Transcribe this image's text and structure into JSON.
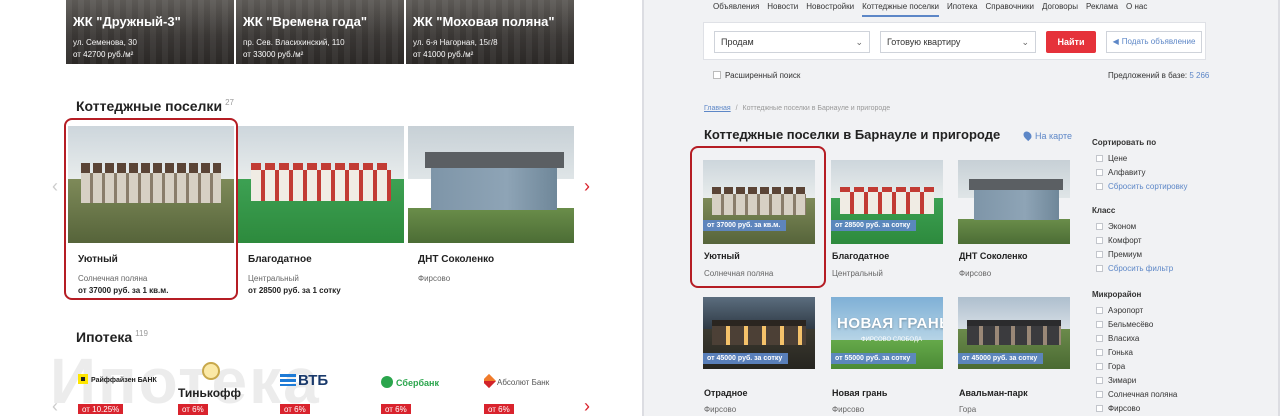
{
  "left": {
    "jk_cards": [
      {
        "name": "ЖК \"Дружный-3\"",
        "address": "ул. Семенова, 30",
        "price": "от 42700 руб./м²"
      },
      {
        "name": "ЖК \"Времена года\"",
        "address": "пр. Сев. Власихинский, 110",
        "price": "от 33000 руб./м²"
      },
      {
        "name": "ЖК \"Моховая поляна\"",
        "address": "ул. 6-я Нагорная, 15г/8",
        "price": "от 41000 руб./м²"
      }
    ],
    "cottages": {
      "title": "Коттеджные поселки",
      "count": "27",
      "arrow_prev": "‹",
      "arrow_next": "›",
      "cards": [
        {
          "title": "Уютный",
          "location": "Солнечная поляна",
          "price": "от 37000 руб. за 1 кв.м."
        },
        {
          "title": "Благодатное",
          "location": "Центральный",
          "price": "от 28500 руб. за 1 сотку"
        },
        {
          "title": "ДНТ Соколенко",
          "location": "Фирсово",
          "price": ""
        }
      ]
    },
    "mortgage": {
      "title": "Ипотека",
      "count": "119",
      "watermark": "Ипотека",
      "arrow_prev": "‹",
      "arrow_next": "›",
      "banks": [
        {
          "name": "Райффайзен БАНК",
          "rate": "от 10.25%"
        },
        {
          "name": "Тинькофф",
          "rate": "от 6%"
        },
        {
          "name": "ВТБ",
          "rate": "от 6%"
        },
        {
          "name": "Сбербанк",
          "rate": "от 6%"
        },
        {
          "name": "Абсолют Банк",
          "rate": "от 6%"
        }
      ]
    }
  },
  "right": {
    "nav": [
      "Объявления",
      "Новости",
      "Новостройки",
      "Коттеджные поселки",
      "Ипотека",
      "Справочники",
      "Договоры",
      "Реклама",
      "О нас"
    ],
    "search": {
      "deal_value": "Продам",
      "type_value": "Готовую квартиру",
      "find_label": "Найти",
      "post_label": "Подать объявление",
      "advanced_label": "Расширенный поиск",
      "offers_label": "Предложений в базе:",
      "offers_count": "5 266"
    },
    "breadcrumb": {
      "home": "Главная",
      "sep": "/",
      "current": "Коттеджные поселки в Барнауле и пригороде"
    },
    "title": "Коттеджные поселки в Барнауле и пригороде",
    "map_link": "На карте",
    "cards": [
      {
        "title": "Уютный",
        "location": "Солнечная поляна",
        "badge": "от 37000 руб. за кв.м."
      },
      {
        "title": "Благодатное",
        "location": "Центральный",
        "badge": "от 28500 руб. за сотку"
      },
      {
        "title": "ДНТ Соколенко",
        "location": "Фирсово",
        "badge": ""
      },
      {
        "title": "Отрадное",
        "location": "Фирсово",
        "badge": "от 45000 руб. за сотку"
      },
      {
        "title": "Новая грань",
        "location": "Фирсово",
        "badge": "от 55000 руб. за сотку",
        "logo": "НОВАЯ ГРАНЬ",
        "logo_sub": "ФИРСОВО СЛОБОДА"
      },
      {
        "title": "Авальман-парк",
        "location": "Гора",
        "badge": "от 45000 руб. за сотку"
      }
    ],
    "filters": {
      "sort_head": "Сортировать по",
      "sort_items": [
        "Цене",
        "Алфавиту"
      ],
      "sort_reset": "Сбросить сортировку",
      "class_head": "Класс",
      "class_items": [
        "Эконом",
        "Комфорт",
        "Премиум"
      ],
      "class_reset": "Сбросить фильтр",
      "district_head": "Микрорайон",
      "district_items": [
        "Аэропорт",
        "Бельмесёво",
        "Власиха",
        "Гонька",
        "Гора",
        "Зимари",
        "Солнечная поляна",
        "Фирсово"
      ]
    }
  },
  "colors": {
    "accent_red": "#d9232d",
    "link_blue": "#5d87c7",
    "highlight_ring": "#b51d24"
  }
}
